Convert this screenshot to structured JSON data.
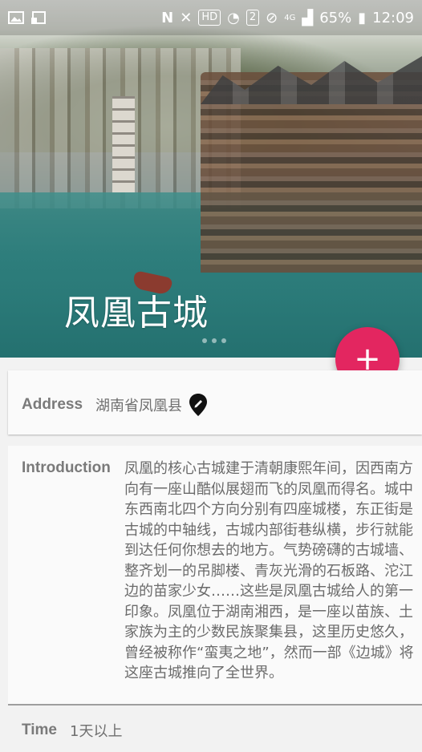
{
  "status_bar": {
    "left_icons": [
      "image-icon",
      "cast-icon"
    ],
    "hd": "HD",
    "sim": "2",
    "network": "4G",
    "battery": "65%",
    "time": "12:09"
  },
  "header": {
    "title": "凤凰古城"
  },
  "fab": {
    "label": "+"
  },
  "address": {
    "label": "Address",
    "value": "湖南省凤凰县"
  },
  "introduction": {
    "label": "Introduction",
    "text": "凤凰的核心古城建于清朝康熙年间，因西南方向有一座山酷似展翅而飞的凤凰而得名。城中东西南北四个方向分别有四座城楼，东正街是古城的中轴线，古城内部街巷纵横，步行就能到达任何你想去的地方。气势磅礴的古城墙、整齐划一的吊脚楼、青灰光滑的石板路、沱江边的苗家少女……这些是凤凰古城给人的第一印象。凤凰位于湖南湘西，是一座以苗族、土家族为主的少数民族聚集县，这里历史悠久，曾经被称作“蛮夷之地”，然而一部《边城》将这座古城推向了全世界。"
  },
  "time": {
    "label": "Time",
    "value": "1天以上"
  },
  "colors": {
    "accent": "#e32660",
    "card": "#fafafa",
    "background": "#f2f2f2"
  }
}
